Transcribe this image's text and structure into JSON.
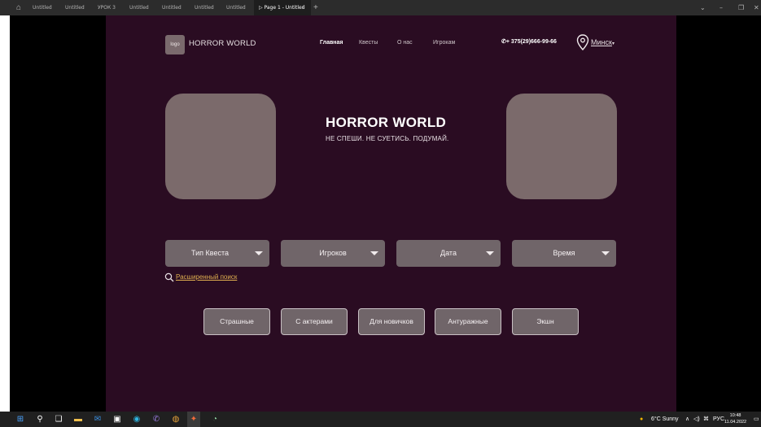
{
  "tabs": {
    "items": [
      "Untitled",
      "Untitled",
      "УРОК 3",
      "Untitled",
      "Untitled",
      "Untitled",
      "Untitled"
    ],
    "active": "Page 1 - Untitled"
  },
  "header": {
    "logo": "logo",
    "brand": "HORROR WORLD",
    "nav": [
      "Главная",
      "Квесты",
      "О нас",
      "Игрокам"
    ],
    "phone": "+ 375(29)666-99-66",
    "city": "Минск"
  },
  "hero": {
    "title": "HORROR WORLD",
    "subtitle": "НЕ СПЕШИ. НЕ СУЕТИСЬ. ПОДУМАЙ."
  },
  "filters": [
    "Тип Квеста",
    "Игроков",
    "Дата",
    "Время"
  ],
  "advanced_search": "Расширенный поиск",
  "categories": [
    "Страшные",
    "С актерами",
    "Для новичков",
    "Антуражные",
    "Экшн"
  ],
  "taskbar": {
    "weather": "6°C  Sunny",
    "lang": "РУС",
    "time": "10:48",
    "date": "11.04.2022"
  },
  "colors": {
    "frame_bg": "#2a0c22",
    "placeholder": "#7b6a6b",
    "control_bg": "#706569",
    "link": "#e0b050"
  }
}
